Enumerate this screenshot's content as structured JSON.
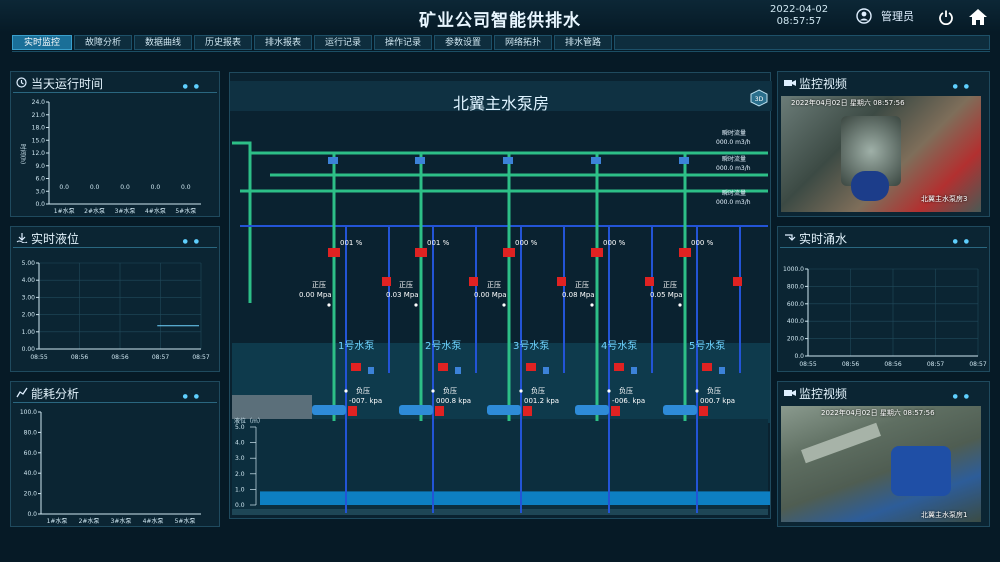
{
  "header": {
    "title": "矿业公司智能供排水",
    "date": "2022-04-02",
    "time": "08:57:57",
    "user": "管理员"
  },
  "nav": {
    "tabs": [
      "实时监控",
      "故障分析",
      "数据曲线",
      "历史报表",
      "排水报表",
      "运行记录",
      "操作记录",
      "参数设置",
      "网络拓扑",
      "排水管路"
    ],
    "active": 0
  },
  "left": {
    "runtime": {
      "title": "当天运行时间",
      "ylabel": "时间(h)",
      "chart_data": {
        "type": "bar",
        "categories": [
          "1#水泵",
          "2#水泵",
          "3#水泵",
          "4#水泵",
          "5#水泵"
        ],
        "values": [
          0.0,
          0.0,
          0.0,
          0.0,
          0.0
        ],
        "value_labels": [
          "0.0",
          "0.0",
          "0.0",
          "0.0",
          "0.0"
        ],
        "ylim": [
          0,
          24
        ],
        "yticks": [
          "24.0",
          "21.0",
          "18.0",
          "15.0",
          "12.0",
          "9.0",
          "6.0",
          "3.0",
          "0.0"
        ]
      }
    },
    "level": {
      "title": "实时液位",
      "chart_data": {
        "type": "line",
        "x": [
          "08:55",
          "08:56",
          "08:56",
          "08:57",
          "08:57"
        ],
        "series": [
          {
            "values": [
              1.35,
              1.35
            ]
          }
        ],
        "x_range_label": "08:57",
        "ylim": [
          0,
          5
        ],
        "yticks": [
          "5.00",
          "4.00",
          "3.00",
          "2.00",
          "1.00",
          "0.00"
        ]
      }
    },
    "energy": {
      "title": "能耗分析",
      "chart_data": {
        "type": "bar",
        "categories": [
          "1#水泵",
          "2#水泵",
          "3#水泵",
          "4#水泵",
          "5#水泵"
        ],
        "values": [
          0,
          0,
          0,
          0,
          0
        ],
        "ylim": [
          0,
          100
        ],
        "yticks": [
          "100.0",
          "80.0",
          "60.0",
          "40.0",
          "20.0",
          "0.0"
        ]
      }
    }
  },
  "center": {
    "title": "北翼主水泵房",
    "flows": [
      {
        "label": "瞬时流量",
        "value": "000.0 m3/h"
      },
      {
        "label": "瞬时流量",
        "value": "000.0 m3/h"
      },
      {
        "label": "瞬时流量",
        "value": "000.0 m3/h"
      }
    ],
    "pumps": [
      {
        "name": "1号水泵",
        "valve": "001 %",
        "pos_label": "正压",
        "pos": "0.00 Mpa",
        "neg_label": "负压",
        "neg": "-007. kpa"
      },
      {
        "name": "2号水泵",
        "valve": "001 %",
        "pos_label": "正压",
        "pos": "0.03 Mpa",
        "neg_label": "负压",
        "neg": "000.8 kpa"
      },
      {
        "name": "3号水泵",
        "valve": "000 %",
        "pos_label": "正压",
        "pos": "0.00 Mpa",
        "neg_label": "负压",
        "neg": "001.2 kpa"
      },
      {
        "name": "4号水泵",
        "valve": "000 %",
        "pos_label": "正压",
        "pos": "0.08 Mpa",
        "neg_label": "负压",
        "neg": "-006. kpa"
      },
      {
        "name": "5号水泵",
        "valve": "000 %",
        "pos_label": "正压",
        "pos": "0.05 Mpa",
        "neg_label": "负压",
        "neg": "000.7 kpa"
      }
    ],
    "level_axis": {
      "label": "液位（m）",
      "ticks": [
        "5.0",
        "4.0",
        "3.0",
        "2.0",
        "1.0",
        "0.0"
      ],
      "level": 1.0
    }
  },
  "right": {
    "video1": {
      "title": "监控视频",
      "timestamp": "2022年04月02日 星期六 08:57:56",
      "caption": "北翼主水泵房3"
    },
    "inflow": {
      "title": "实时涌水",
      "chart_data": {
        "type": "line",
        "x": [
          "08:55",
          "08:56",
          "08:56",
          "08:57",
          "08:57"
        ],
        "series": [],
        "ylim": [
          0,
          1000
        ],
        "yticks": [
          "1000.0",
          "800.0",
          "600.0",
          "400.0",
          "200.0",
          "0.0"
        ]
      }
    },
    "video2": {
      "title": "监控视频",
      "timestamp": "2022年04月02日 星期六 08:57:56",
      "caption": "北翼主水泵房1"
    }
  },
  "colors": {
    "accent": "#1a6f98",
    "pipe_green": "#2dbf87",
    "pipe_blue": "#2354d6",
    "valve_red": "#e02222",
    "water": "#0d7fc2"
  }
}
